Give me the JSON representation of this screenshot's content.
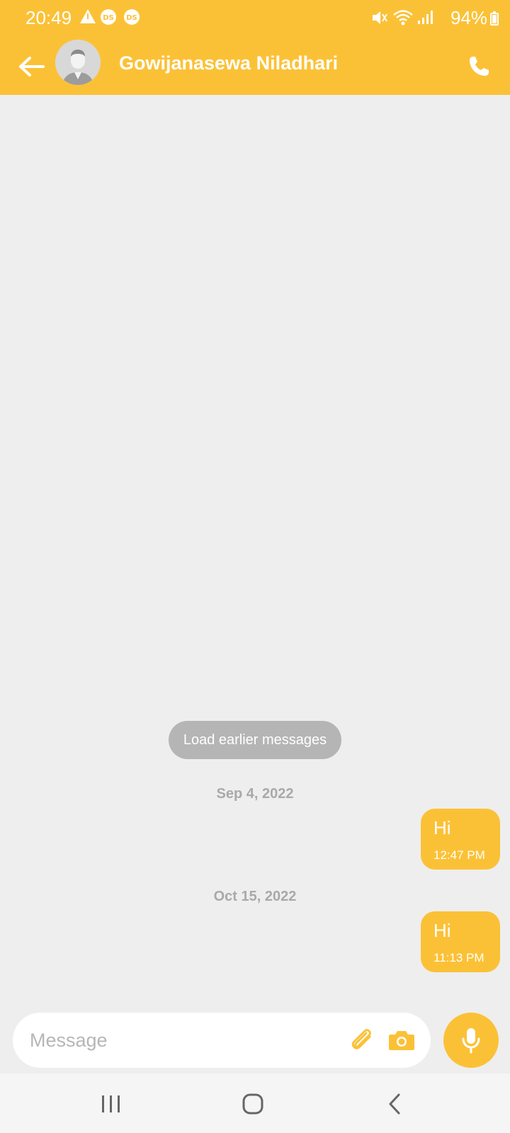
{
  "status_bar": {
    "time": "20:49",
    "battery": "94%",
    "icons": [
      "warning-icon",
      "ds-icon",
      "ds-icon",
      "mute-icon",
      "wifi-icon",
      "signal-icon",
      "battery-icon"
    ]
  },
  "header": {
    "contact_name": "Gowijanasewa Niladhari",
    "icons": [
      "back-arrow-icon",
      "avatar",
      "phone-icon"
    ]
  },
  "chat": {
    "load_earlier": "Load earlier messages",
    "groups": [
      {
        "date": "Sep 4, 2022",
        "messages": [
          {
            "text": "Hi",
            "time": "12:47 PM"
          }
        ]
      },
      {
        "date": "Oct 15, 2022",
        "messages": [
          {
            "text": "Hi",
            "time": "11:13 PM"
          }
        ]
      }
    ]
  },
  "composer": {
    "placeholder": "Message",
    "icons": [
      "paperclip-icon",
      "camera-icon",
      "mic-icon"
    ]
  },
  "nav": {
    "icons": [
      "recent-apps-icon",
      "home-icon",
      "back-icon"
    ]
  },
  "colors": {
    "accent": "#fbc136",
    "background": "#eeeeee"
  }
}
